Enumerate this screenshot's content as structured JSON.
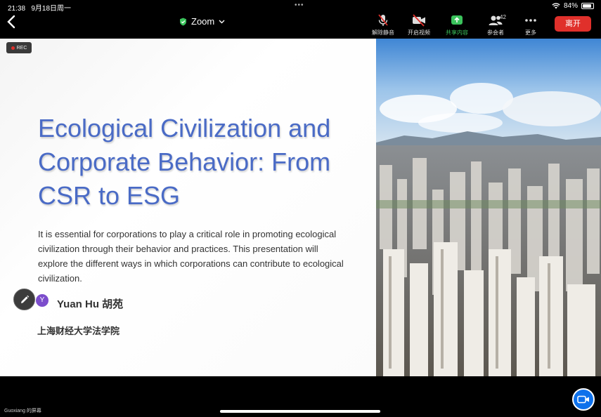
{
  "status_bar": {
    "time": "21:38",
    "date": "9月18日周一",
    "battery": "84%",
    "battery_level": 0.84
  },
  "toolbar": {
    "meeting_title": "Zoom",
    "mute_label": "解除静音",
    "video_label": "开启视频",
    "share_label": "共享内容",
    "participants_label": "参会者",
    "participants_count": "42",
    "more_label": "更多",
    "leave_label": "离开",
    "colors": {
      "share": "#3bc35c",
      "leave": "#e0302b"
    }
  },
  "slide": {
    "rec_label": "REC",
    "title": "Ecological Civilization and Corporate Behavior: From CSR to ESG",
    "body": "It is essential for corporations to play a critical role in promoting ecological civilization through their behavior and practices. This presentation will explore the different ways in which corporations can contribute to ecological civilization.",
    "avatar_initial": "Y",
    "presenter": "Yuan Hu  胡苑",
    "affiliation": "上海财经大学法学院",
    "title_color": "#4a6bc6"
  },
  "footer": {
    "screen_owner": "Guoxiang 的屏幕"
  }
}
